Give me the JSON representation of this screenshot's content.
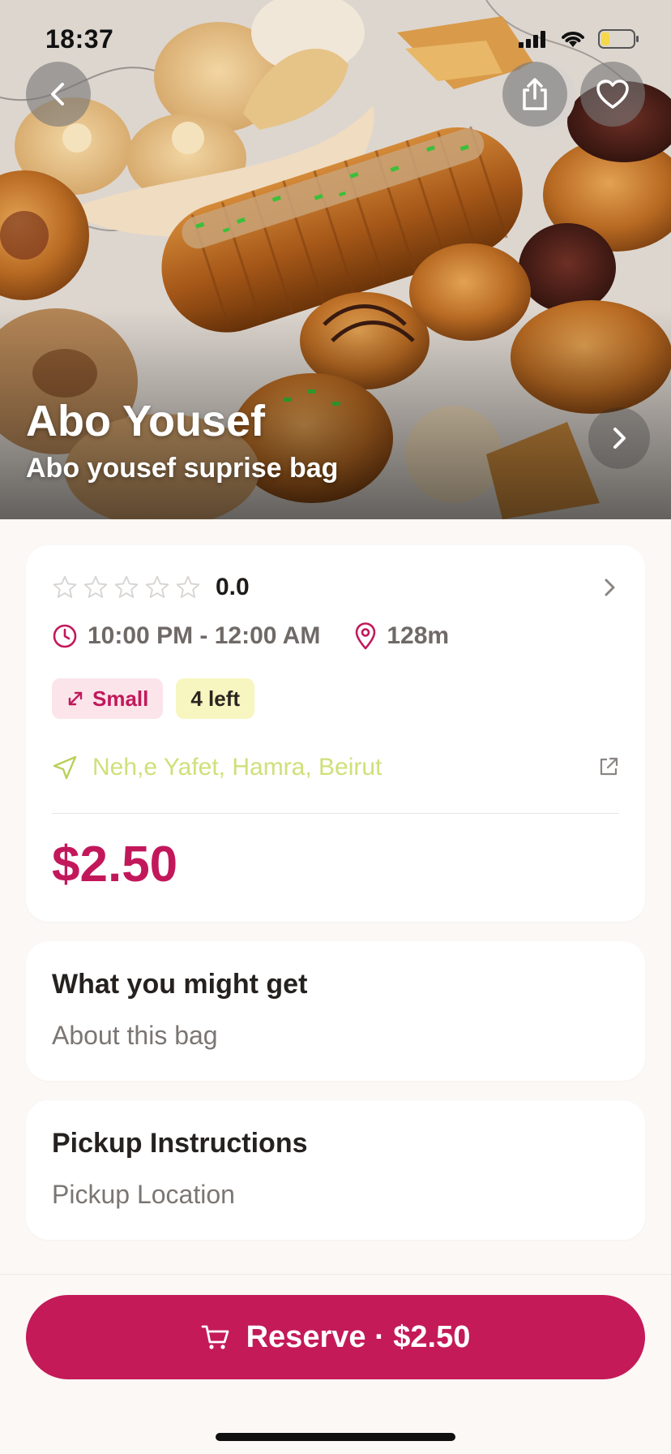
{
  "status_bar": {
    "time": "18:37"
  },
  "hero": {
    "store_name": "Abo Yousef",
    "bag_name": "Abo yousef suprise bag"
  },
  "icons": {
    "back": "chevron-left-icon",
    "share": "share-icon",
    "favorite": "heart-icon",
    "next": "chevron-right-icon",
    "clock": "clock-icon",
    "location": "map-pin-icon",
    "size": "resize-arrow-icon",
    "navigation": "navigation-arrow-icon",
    "external": "external-link-icon",
    "cart": "cart-icon"
  },
  "details": {
    "rating_value": "0.0",
    "stars_filled": 0,
    "stars_total": 5,
    "pickup_time": "10:00 PM - 12:00 AM",
    "distance": "128m",
    "size_tag": "Small",
    "quantity_tag": "4 left",
    "address": "Neh,e Yafet, Hamra, Beirut",
    "price": "$2.50"
  },
  "sections": {
    "bag_title": "What you might get",
    "bag_subtitle": "About this bag",
    "pickup_title": "Pickup Instructions",
    "pickup_subtitle": "Pickup Location"
  },
  "action": {
    "reserve_label": "Reserve · $2.50"
  },
  "colors": {
    "brand": "#c41a58",
    "address": "#cfe079",
    "tag_size_bg": "#fbe4ea",
    "tag_left_bg": "#f7f6c0",
    "background": "#fcf8f6"
  }
}
